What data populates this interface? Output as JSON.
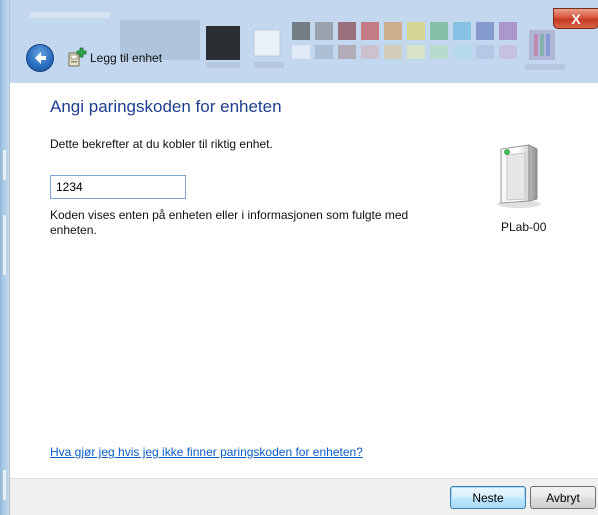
{
  "window": {
    "title": "Legg til enhet",
    "close_glyph": "X",
    "back_icon": "back-arrow-icon",
    "title_icon": "add-device-icon"
  },
  "main": {
    "heading": "Angi paringskoden for enheten",
    "description": "Dette bekrefter at du kobler til riktig enhet.",
    "code_input": {
      "value": "1234"
    },
    "hint": "Koden vises enten på enheten eller i informasjonen som fulgte med enheten.",
    "device": {
      "icon": "printer-device-icon",
      "label": "PLab-00"
    },
    "help_link": "Hva gjør jeg hvis jeg ikke finner paringskoden for enheten?"
  },
  "footer": {
    "next_label": "Neste",
    "cancel_label": "Avbryt"
  },
  "colors": {
    "heading": "#1e3e8e",
    "link": "#0c5cc6",
    "close_button": "#c23a20",
    "footer_bg": "#f0f0f0"
  }
}
